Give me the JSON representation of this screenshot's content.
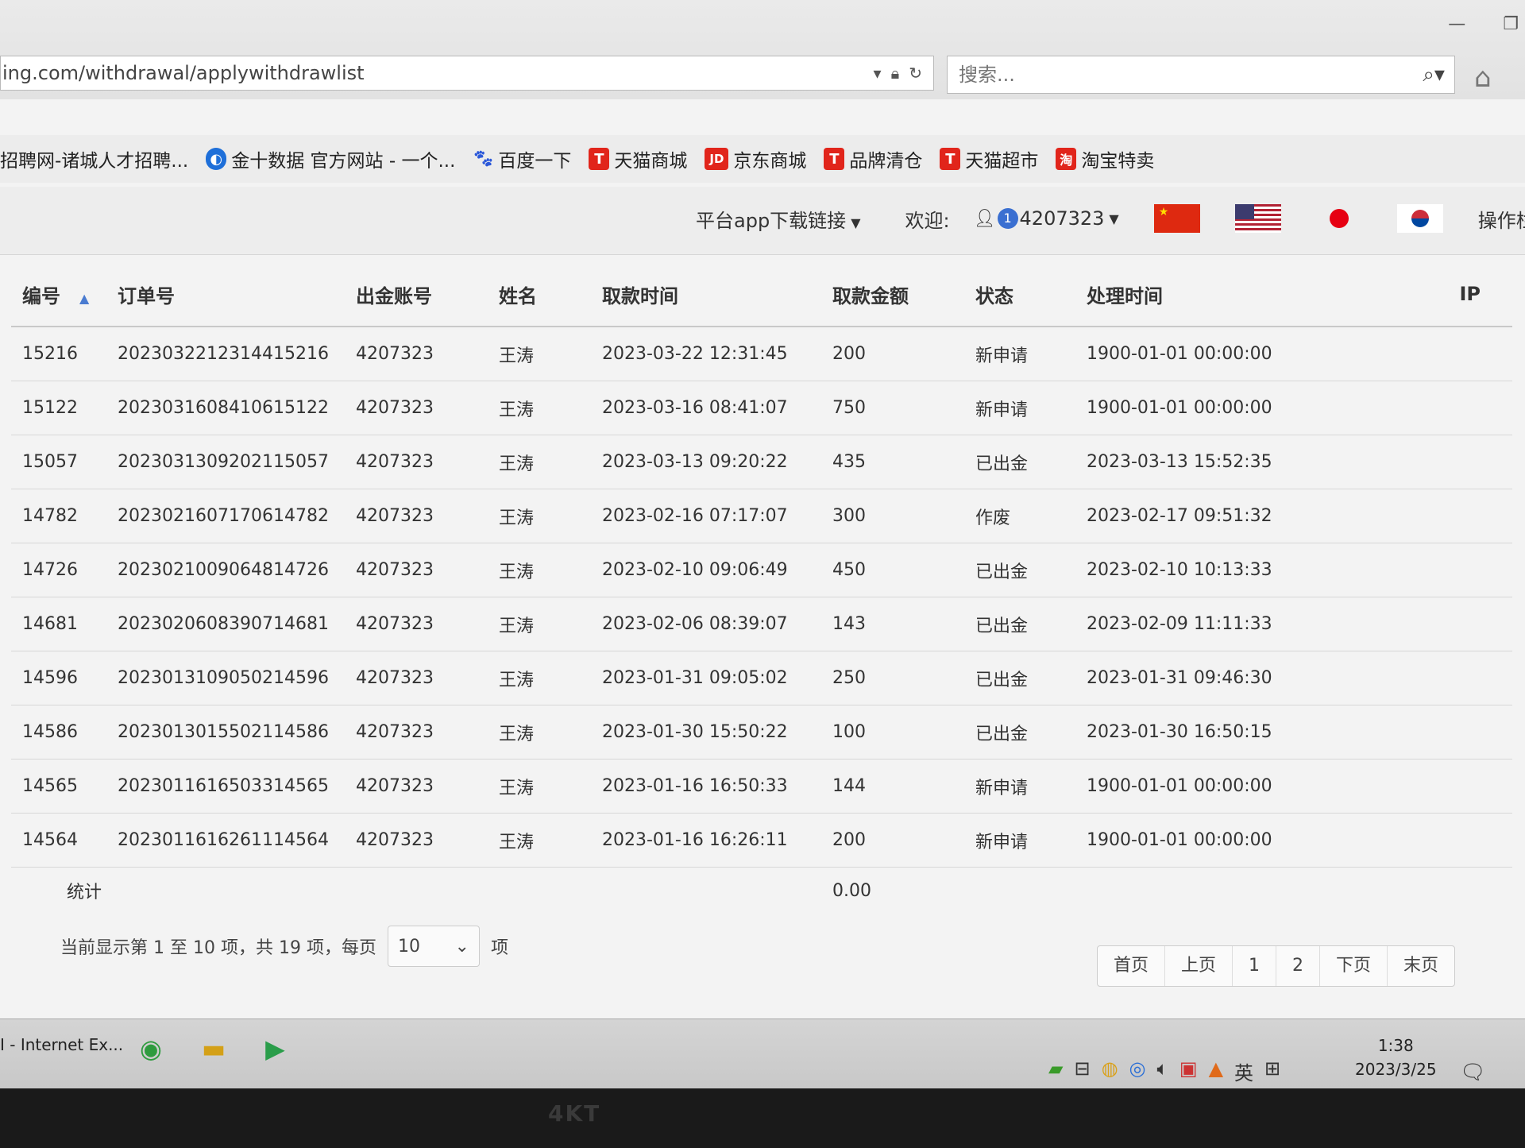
{
  "browser": {
    "url": "ing.com/withdrawal/applywithdrawlist",
    "search_placeholder": "搜索...",
    "favorites": [
      {
        "label": "招聘网-诸城人才招聘...",
        "icon": "none",
        "color": ""
      },
      {
        "label": "金十数据 官方网站 - 一个...",
        "icon": "jin10-icon",
        "color": "#1e6fd9"
      },
      {
        "label": "百度一下",
        "icon": "baidu-paw-icon",
        "color": "#2b58d9"
      },
      {
        "label": "天猫商城",
        "icon": "T",
        "color": "#e1251b"
      },
      {
        "label": "京东商城",
        "icon": "JD",
        "color": "#e1251b"
      },
      {
        "label": "品牌清仓",
        "icon": "T",
        "color": "#e1251b"
      },
      {
        "label": "天猫超市",
        "icon": "T",
        "color": "#e1251b"
      },
      {
        "label": "淘宝特卖",
        "icon": "淘",
        "color": "#e1251b"
      }
    ]
  },
  "header": {
    "download_link": "平台app下载链接",
    "welcome_label": "欢迎:",
    "user_badge": "1",
    "user_id": "4207323",
    "op_label": "操作栏"
  },
  "table": {
    "columns": [
      "编号",
      "订单号",
      "出金账号",
      "姓名",
      "取款时间",
      "取款金额",
      "状态",
      "处理时间",
      "IP"
    ],
    "rows": [
      [
        "15216",
        "2023032212314415216",
        "4207323",
        "王涛",
        "2023-03-22 12:31:45",
        "200",
        "新申请",
        "1900-01-01 00:00:00",
        ""
      ],
      [
        "15122",
        "2023031608410615122",
        "4207323",
        "王涛",
        "2023-03-16 08:41:07",
        "750",
        "新申请",
        "1900-01-01 00:00:00",
        ""
      ],
      [
        "15057",
        "2023031309202115057",
        "4207323",
        "王涛",
        "2023-03-13 09:20:22",
        "435",
        "已出金",
        "2023-03-13 15:52:35",
        ""
      ],
      [
        "14782",
        "2023021607170614782",
        "4207323",
        "王涛",
        "2023-02-16 07:17:07",
        "300",
        "作废",
        "2023-02-17 09:51:32",
        ""
      ],
      [
        "14726",
        "2023021009064814726",
        "4207323",
        "王涛",
        "2023-02-10 09:06:49",
        "450",
        "已出金",
        "2023-02-10 10:13:33",
        ""
      ],
      [
        "14681",
        "2023020608390714681",
        "4207323",
        "王涛",
        "2023-02-06 08:39:07",
        "143",
        "已出金",
        "2023-02-09 11:11:33",
        ""
      ],
      [
        "14596",
        "2023013109050214596",
        "4207323",
        "王涛",
        "2023-01-31 09:05:02",
        "250",
        "已出金",
        "2023-01-31 09:46:30",
        ""
      ],
      [
        "14586",
        "2023013015502114586",
        "4207323",
        "王涛",
        "2023-01-30 15:50:22",
        "100",
        "已出金",
        "2023-01-30 16:50:15",
        ""
      ],
      [
        "14565",
        "2023011616503314565",
        "4207323",
        "王涛",
        "2023-01-16 16:50:33",
        "144",
        "新申请",
        "1900-01-01 00:00:00",
        ""
      ],
      [
        "14564",
        "2023011616261114564",
        "4207323",
        "王涛",
        "2023-01-16 16:26:11",
        "200",
        "新申请",
        "1900-01-01 00:00:00",
        ""
      ]
    ],
    "stat_label": "统计",
    "stat_total": "0.00"
  },
  "footer": {
    "info_prefix": "当前显示第 1 至 10 项，共 19 项，每页",
    "page_size": "10",
    "info_suffix": "项",
    "pager": [
      "首页",
      "上页",
      "1",
      "2",
      "下页",
      "末页"
    ]
  },
  "taskbar": {
    "ie_label": "I - Internet Ex...",
    "ime": "英",
    "time": "1:38",
    "date": "2023/3/25"
  },
  "monitor_brand": "4KT"
}
